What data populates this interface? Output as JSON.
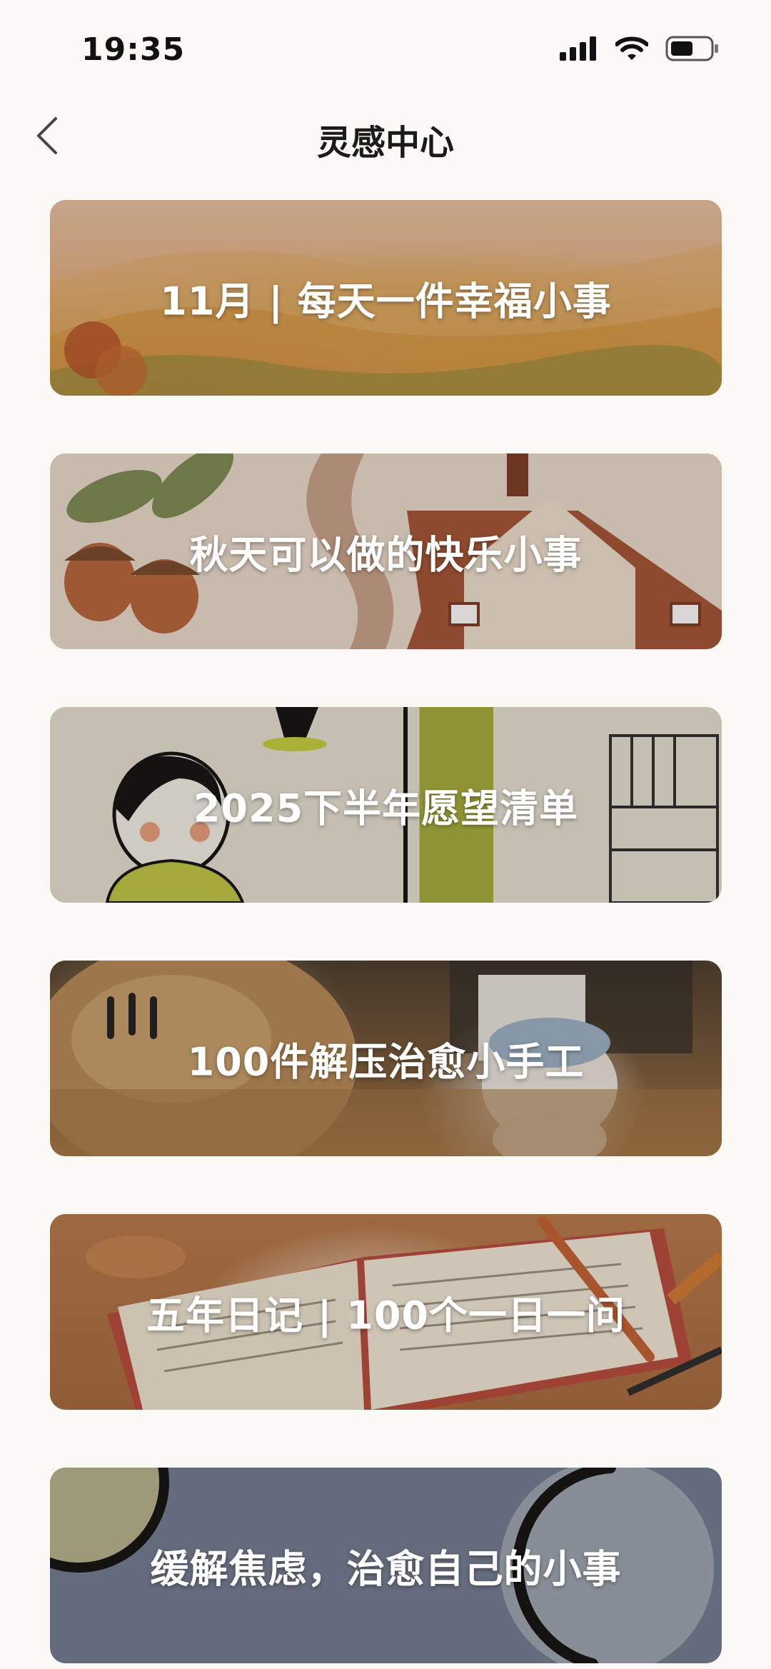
{
  "status_bar": {
    "time": "19:35"
  },
  "header": {
    "title": "灵感中心"
  },
  "cards": [
    {
      "title": "11月 | 每天一件幸福小事"
    },
    {
      "title": "秋天可以做的快乐小事"
    },
    {
      "title": "2025下半年愿望清单"
    },
    {
      "title": "100件解压治愈小手工"
    },
    {
      "title": "五年日记 | 100个一日一问"
    },
    {
      "title": "缓解焦虑，治愈自己的小事"
    }
  ],
  "colors": {
    "background": "#FBF9F6",
    "title_text": "#1b1b1b",
    "card_text": "#ffffff"
  },
  "icons": {
    "back": "chevron-left-icon",
    "signal": "signal-icon",
    "wifi": "wifi-icon",
    "battery": "battery-icon"
  }
}
